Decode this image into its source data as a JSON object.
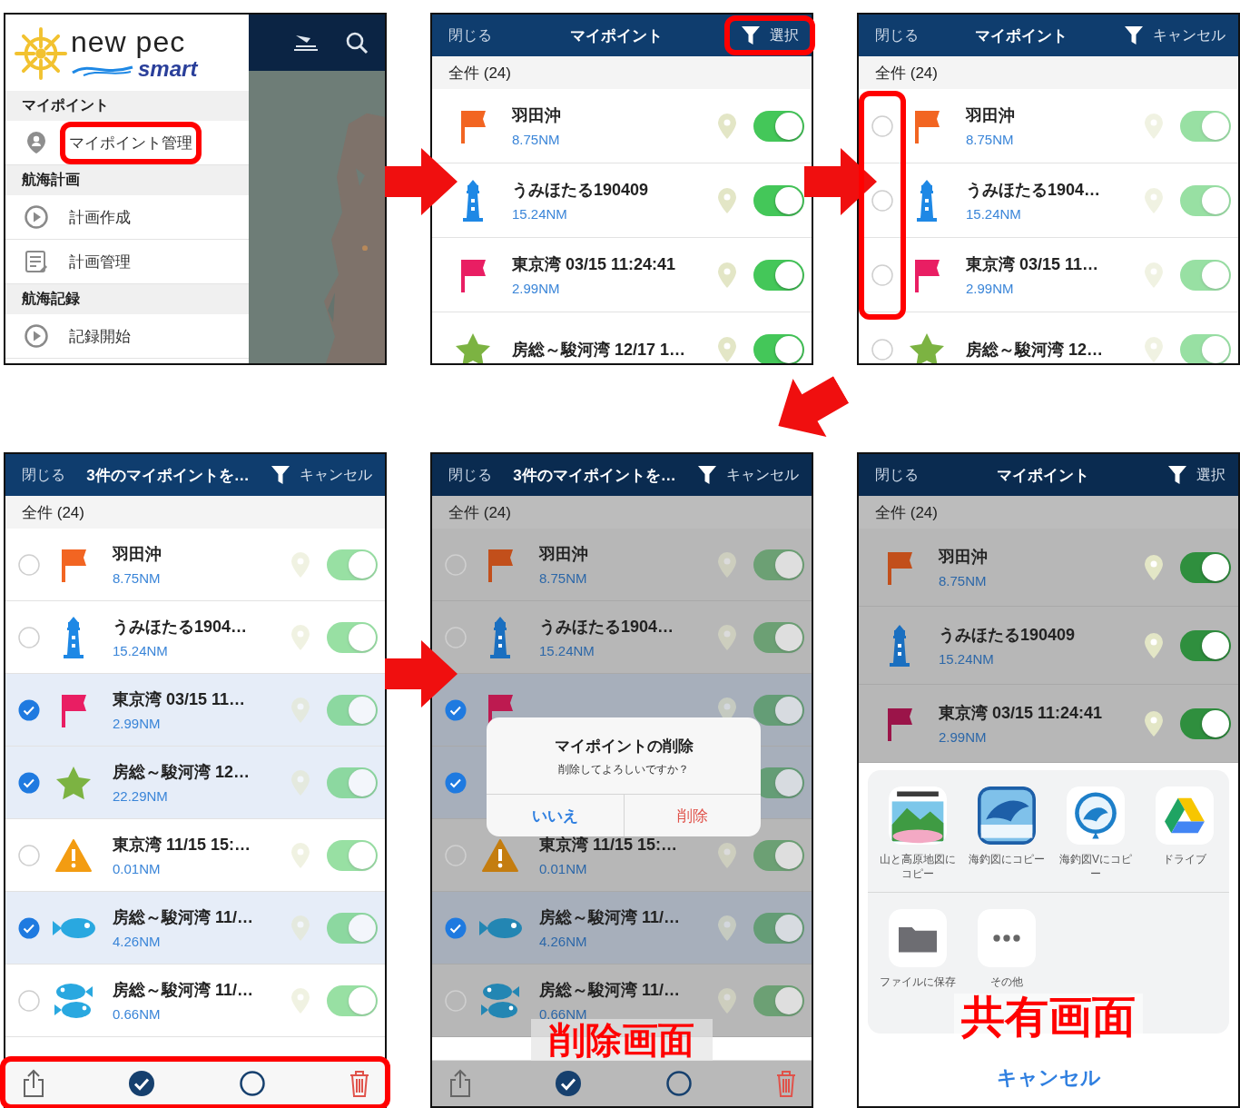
{
  "panels": [
    {
      "kind": "menu",
      "logo": {
        "name": "new pec",
        "tagline": "smart"
      },
      "sections": [
        {
          "heading": "マイポイント",
          "items": [
            {
              "label": "マイポイント管理",
              "kind": "pin",
              "highlighted": true
            }
          ]
        },
        {
          "heading": "航海計画",
          "items": [
            {
              "label": "計画作成",
              "kind": "play"
            },
            {
              "label": "計画管理",
              "kind": "list"
            }
          ]
        },
        {
          "heading": "航海記録",
          "items": [
            {
              "label": "記録開始",
              "kind": "play"
            }
          ]
        }
      ]
    },
    {
      "kind": "list",
      "selecting": false,
      "header": {
        "close": "閉じる",
        "title": "マイポイント",
        "action": "選択",
        "action_highlighted": true
      },
      "summary": "全件 (24)",
      "rows": [
        {
          "kind": "flag",
          "color": "#f26522",
          "name": "羽田沖",
          "distance": "8.75NM",
          "on": true
        },
        {
          "kind": "lighthouse",
          "color": "#1e88e5",
          "name": "うみほたる190409",
          "distance": "15.24NM",
          "on": true
        },
        {
          "kind": "flag",
          "color": "#e91e63",
          "name": "東京湾 03/15 11:24:41",
          "distance": "2.99NM",
          "on": true
        },
        {
          "kind": "star",
          "color": "#7cb342",
          "name": "房総～駿河湾 12/17 1…",
          "on": true
        }
      ]
    },
    {
      "kind": "list",
      "selecting": true,
      "checkboxes_highlighted": true,
      "header": {
        "close": "閉じる",
        "title": "マイポイント",
        "action": "キャンセル"
      },
      "summary": "全件 (24)",
      "rows": [
        {
          "kind": "flag",
          "color": "#f26522",
          "name": "羽田沖",
          "distance": "8.75NM",
          "on": true,
          "checked": false
        },
        {
          "kind": "lighthouse",
          "color": "#1e88e5",
          "name": "うみほたる1904…",
          "distance": "15.24NM",
          "on": true,
          "checked": false
        },
        {
          "kind": "flag",
          "color": "#e91e63",
          "name": "東京湾 03/15 11…",
          "distance": "2.99NM",
          "on": true,
          "checked": false
        },
        {
          "kind": "star",
          "color": "#7cb342",
          "name": "房総～駿河湾 12…",
          "on": true,
          "checked": false
        }
      ]
    },
    {
      "kind": "list",
      "selecting": true,
      "toolbar": true,
      "toolbar_highlighted": true,
      "header": {
        "close": "閉じる",
        "title": "3件のマイポイントを…",
        "action": "キャンセル"
      },
      "summary": "全件 (24)",
      "rows": [
        {
          "kind": "flag",
          "color": "#f26522",
          "name": "羽田沖",
          "distance": "8.75NM",
          "on": true,
          "checked": false
        },
        {
          "kind": "lighthouse",
          "color": "#1e88e5",
          "name": "うみほたる1904…",
          "distance": "15.24NM",
          "on": true,
          "checked": false
        },
        {
          "kind": "flag",
          "color": "#e91e63",
          "name": "東京湾 03/15 11…",
          "distance": "2.99NM",
          "on": true,
          "checked": true
        },
        {
          "kind": "star",
          "color": "#7cb342",
          "name": "房総～駿河湾 12…",
          "distance": "22.29NM",
          "on": true,
          "checked": true
        },
        {
          "kind": "warning",
          "color": "#f39c12",
          "name": "東京湾 11/15 15:…",
          "distance": "0.01NM",
          "on": true,
          "checked": false
        },
        {
          "kind": "fish",
          "color": "#29a8e0",
          "name": "房総～駿河湾 11/…",
          "distance": "4.26NM",
          "on": true,
          "checked": true
        },
        {
          "kind": "fish-pair",
          "color": "#29a8e0",
          "name": "房総～駿河湾 11/…",
          "distance": "0.66NM",
          "on": true,
          "checked": false
        }
      ]
    },
    {
      "kind": "list",
      "selecting": true,
      "toolbar": true,
      "dimmed": true,
      "caption": "削除画面",
      "header": {
        "close": "閉じる",
        "title": "3件のマイポイントを…",
        "action": "キャンセル"
      },
      "summary": "全件 (24)",
      "rows": [
        {
          "kind": "flag",
          "color": "#c24f1b",
          "name": "羽田沖",
          "distance": "8.75NM",
          "on": true,
          "checked": false
        },
        {
          "kind": "lighthouse",
          "color": "#1a6fc0",
          "name": "うみほたる1904…",
          "distance": "15.24NM",
          "on": true,
          "checked": false
        },
        {
          "kind": "flag",
          "color": "#bd1a50",
          "on": true,
          "checked": true
        },
        {
          "on": true,
          "checked": true
        },
        {
          "kind": "warning",
          "color": "#c47d10",
          "name": "東京湾 11/15 15:…",
          "distance": "0.01NM",
          "on": true,
          "checked": false
        },
        {
          "kind": "fish",
          "color": "#2386b3",
          "name": "房総～駿河湾 11/…",
          "distance": "4.26NM",
          "on": true,
          "checked": true
        },
        {
          "kind": "fish-pair",
          "color": "#2386b3",
          "name": "房総～駿河湾 11/…",
          "distance": "0.66NM",
          "on": true,
          "checked": false
        }
      ],
      "dialog": {
        "title": "マイポイントの削除",
        "message": "削除してよろしいですか？",
        "buttons": [
          {
            "label": "いいえ",
            "kind": "cancel"
          },
          {
            "label": "削除",
            "kind": "destructive"
          }
        ]
      }
    },
    {
      "kind": "list",
      "selecting": false,
      "dimmed": true,
      "caption": "共有画面",
      "header": {
        "close": "閉じる",
        "title": "マイポイント",
        "action": "選択"
      },
      "summary": "全件 (24)",
      "rows": [
        {
          "kind": "flag",
          "color": "#c24f1b",
          "name": "羽田沖",
          "distance": "8.75NM",
          "on": true
        },
        {
          "kind": "lighthouse",
          "color": "#1a6fc0",
          "name": "うみほたる190409",
          "distance": "15.24NM",
          "on": true
        },
        {
          "kind": "flag",
          "color": "#9b1449",
          "name": "東京湾 03/15 11:24:41",
          "distance": "2.99NM",
          "on": true
        }
      ],
      "share": {
        "apps": [
          {
            "label": "山と高原地図にコピー",
            "kind": "mountain-map"
          },
          {
            "label": "海釣図にコピー",
            "kind": "fishing-chart"
          },
          {
            "label": "海釣図Vにコピー",
            "kind": "fishing-pin"
          },
          {
            "label": "ドライブ",
            "kind": "drive"
          }
        ],
        "actions": [
          {
            "label": "ファイルに保存",
            "kind": "folder"
          },
          {
            "label": "その他",
            "kind": "more"
          }
        ],
        "cancel": "キャンセル"
      }
    }
  ]
}
